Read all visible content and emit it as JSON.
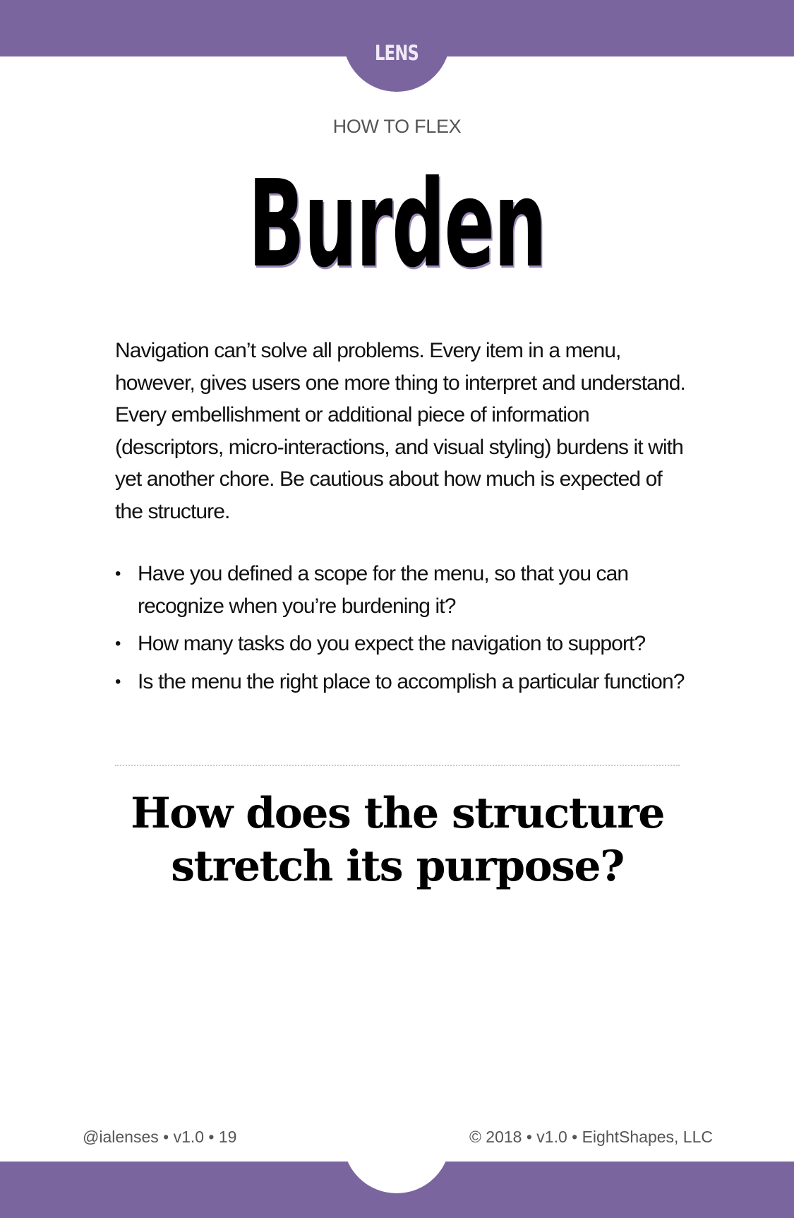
{
  "header": {
    "tab_label": "LENS"
  },
  "card": {
    "eyebrow": "HOW TO FLEX",
    "title": "Burden",
    "description": "Navigation can’t solve all problems. Every item in a menu, however, gives users one more thing to interpret and understand. Every embellishment or additional piece of information (descriptors, micro-interactions, and visual styling) burdens it with yet another chore. Be cautious about how much is expected of the structure.",
    "questions": [
      "Have you defined a scope for the menu, so that you can recognize when you’re burdening it?",
      "How many tasks do you expect the navigation to support?",
      "Is the menu the right place to accomplish a particular function?"
    ],
    "prompt": "How does the structure stretch its purpose?"
  },
  "footer": {
    "left": "@ialenses • v1.0 •  19",
    "right": "© 2018 • v1.0 • EightShapes, LLC"
  },
  "colors": {
    "brand_purple": "#7b659e"
  }
}
